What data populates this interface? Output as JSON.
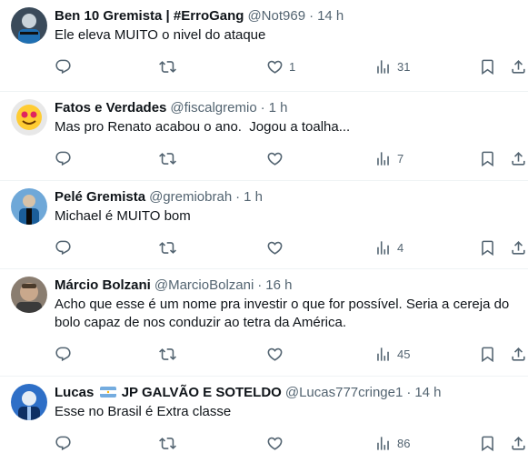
{
  "tweets": [
    {
      "name": "Ben 10 Gremista | #ErroGang",
      "handle": "@Not969",
      "time": "14 h",
      "text": "Ele eleva MUITO o nivel do ataque",
      "replies": "",
      "retweets": "",
      "likes": "1",
      "views": "31"
    },
    {
      "name": "Fatos e Verdades",
      "handle": "@fiscalgremio",
      "time": "1 h",
      "text": "Mas pro Renato acabou o ano.  Jogou a toalha...",
      "replies": "",
      "retweets": "",
      "likes": "",
      "views": "7"
    },
    {
      "name": "Pelé Gremista",
      "handle": "@gremiobrah",
      "time": "1 h",
      "text": "Michael é MUITO bom",
      "replies": "",
      "retweets": "",
      "likes": "",
      "views": "4"
    },
    {
      "name": "Márcio Bolzani",
      "handle": "@MarcioBolzani",
      "time": "16 h",
      "text": "Acho que esse é um nome pra investir o que for possível. Seria a cereja do bolo capaz de nos conduzir ao tetra da América.",
      "replies": "",
      "retweets": "",
      "likes": "",
      "views": "45"
    },
    {
      "name_prefix": "Lucas",
      "name_suffix": "JP GALVÃO E SOTELDO",
      "handle": "@Lucas777cringe1",
      "time": "14 h",
      "text": "Esse no Brasil é Extra classe",
      "replies": "",
      "retweets": "",
      "likes": "",
      "views": "86"
    }
  ],
  "separator": "·",
  "icons": {
    "reply": "reply-icon",
    "retweet": "retweet-icon",
    "like": "heart-icon",
    "views": "views-icon",
    "bookmark": "bookmark-icon",
    "share": "share-icon",
    "more": "more-icon"
  },
  "colors": {
    "text": "#0f1419",
    "secondary": "#536471",
    "divider": "#eff3f4"
  }
}
